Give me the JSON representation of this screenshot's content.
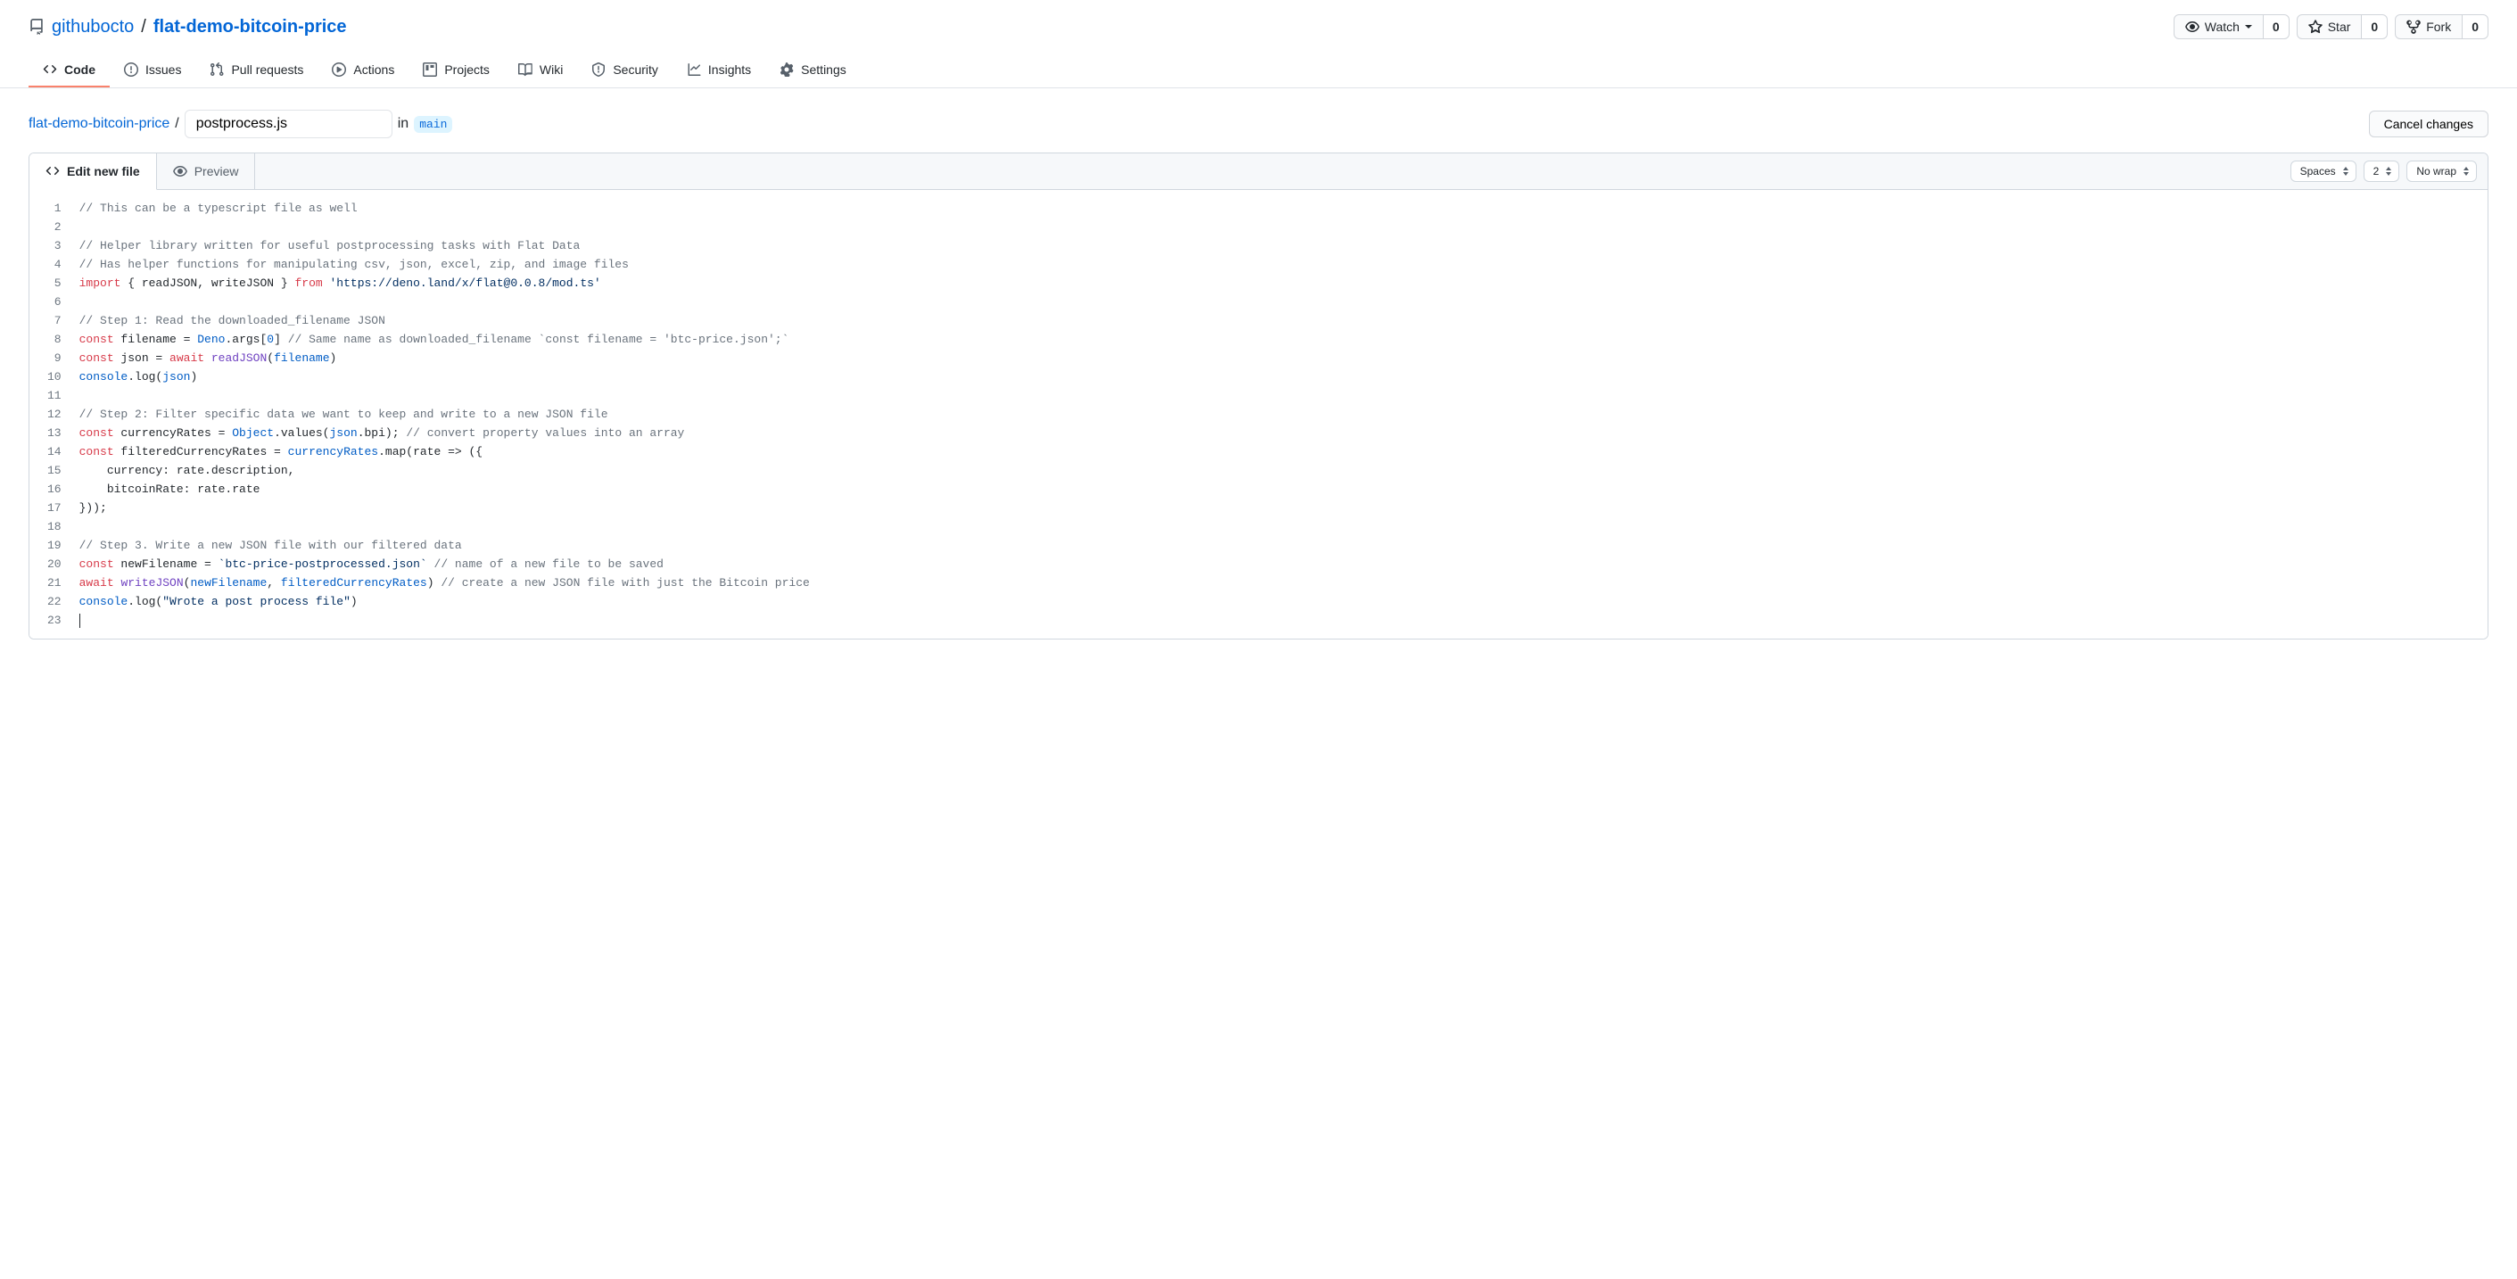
{
  "repo": {
    "owner": "githubocto",
    "name": "flat-demo-bitcoin-price",
    "actions": {
      "watch": {
        "label": "Watch",
        "count": "0"
      },
      "star": {
        "label": "Star",
        "count": "0"
      },
      "fork": {
        "label": "Fork",
        "count": "0"
      }
    }
  },
  "nav": {
    "code": "Code",
    "issues": "Issues",
    "pulls": "Pull requests",
    "actions": "Actions",
    "projects": "Projects",
    "wiki": "Wiki",
    "security": "Security",
    "insights": "Insights",
    "settings": "Settings"
  },
  "editor": {
    "root_link": "flat-demo-bitcoin-price",
    "filename": "postprocess.js",
    "in_label": "in",
    "branch": "main",
    "cancel_label": "Cancel changes",
    "tabs": {
      "edit": "Edit new file",
      "preview": "Preview"
    },
    "options": {
      "indent": "Spaces",
      "indent_size": "2",
      "wrap": "No wrap"
    }
  },
  "code": {
    "lines": [
      "1",
      "2",
      "3",
      "4",
      "5",
      "6",
      "7",
      "8",
      "9",
      "10",
      "11",
      "12",
      "13",
      "14",
      "15",
      "16",
      "17",
      "18",
      "19",
      "20",
      "21",
      "22",
      "23"
    ],
    "l1": "// This can be a typescript file as well",
    "l3": "// Helper library written for useful postprocessing tasks with Flat Data",
    "l4": "// Has helper functions for manipulating csv, json, excel, zip, and image files",
    "l5": {
      "imp": "import",
      "body": " { readJSON, writeJSON } ",
      "from": "from",
      "str": " 'https://deno.land/x/flat@0.0.8/mod.ts'"
    },
    "l7": "// Step 1: Read the downloaded_filename JSON",
    "l8": {
      "kw": "const",
      "v": " filename = ",
      "deno": "Deno",
      "rest": ".args[",
      "n": "0",
      "rest2": "] ",
      "com": "// Same name as downloaded_filename `const filename = 'btc-price.json';`"
    },
    "l9": {
      "kw": "const",
      "v": " json = ",
      "aw": "await",
      "sp": " ",
      "fn": "readJSON",
      "open": "(",
      "arg": "filename",
      "close": ")"
    },
    "l10": {
      "c": "console",
      "log": ".log(",
      "arg": "json",
      "close": ")"
    },
    "l12": "// Step 2: Filter specific data we want to keep and write to a new JSON file",
    "l13": {
      "kw": "const",
      "v": " currencyRates = ",
      "obj": "Object",
      "m": ".values(",
      "j": "json",
      "rest": ".bpi); ",
      "com": "// convert property values into an array"
    },
    "l14": {
      "kw": "const",
      "v": " filteredCurrencyRates = ",
      "cr": "currencyRates",
      "rest": ".map(rate => ({"
    },
    "l15": "    currency: rate.description,",
    "l16": "    bitcoinRate: rate.rate",
    "l17": "}));",
    "l19": "// Step 3. Write a new JSON file with our filtered data",
    "l20": {
      "kw": "const",
      "v": " newFilename = ",
      "str": "`btc-price-postprocessed.json`",
      "sp": " ",
      "com": "// name of a new file to be saved"
    },
    "l21": {
      "aw": "await",
      "sp": " ",
      "fn": "writeJSON",
      "open": "(",
      "a1": "newFilename",
      "comma": ", ",
      "a2": "filteredCurrencyRates",
      "close": ") ",
      "com": "// create a new JSON file with just the Bitcoin price"
    },
    "l22": {
      "c": "console",
      "rest": ".log(",
      "str": "\"Wrote a post process file\"",
      "close": ")"
    }
  }
}
